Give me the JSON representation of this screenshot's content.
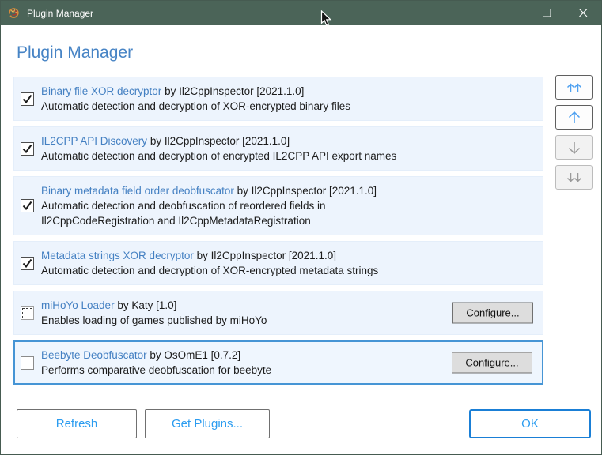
{
  "window": {
    "title": "Plugin Manager"
  },
  "header": {
    "title": "Plugin Manager"
  },
  "plugins": [
    {
      "name": "Binary file XOR decryptor",
      "byline": " by Il2CppInspector [2021.1.0]",
      "description": "Automatic detection and decryption of XOR-encrypted binary files",
      "state": "checked",
      "selected": false
    },
    {
      "name": "IL2CPP API Discovery",
      "byline": " by Il2CppInspector [2021.1.0]",
      "description": "Automatic detection and decryption of encrypted IL2CPP API export names",
      "state": "checked",
      "selected": false
    },
    {
      "name": "Binary metadata field order deobfuscator",
      "byline": " by Il2CppInspector [2021.1.0]",
      "description": "Automatic detection and deobfuscation of reordered fields in\nIl2CppCodeRegistration and Il2CppMetadataRegistration",
      "state": "checked",
      "selected": false
    },
    {
      "name": "Metadata strings XOR decryptor",
      "byline": " by Il2CppInspector [2021.1.0]",
      "description": "Automatic detection and decryption of XOR-encrypted metadata strings",
      "state": "checked",
      "selected": false
    },
    {
      "name": "miHoYo Loader",
      "byline": " by Katy [1.0]",
      "description": "Enables loading of games published by miHoYo",
      "state": "indeterminate",
      "selected": false,
      "configure_label": "Configure..."
    },
    {
      "name": "Beebyte Deobfuscator",
      "byline": " by OsOmE1 [0.7.2]",
      "description": "Performs comparative deobfuscation for beebyte",
      "state": "unchecked",
      "selected": true,
      "configure_label": "Configure..."
    }
  ],
  "footer": {
    "refresh_label": "Refresh",
    "get_plugins_label": "Get Plugins...",
    "ok_label": "OK"
  },
  "colors": {
    "titlebar": "#4b6458",
    "row_background": "#edf4fd",
    "selected_row_border": "#4695d5",
    "plugin_name_link": "#4480c2",
    "accent_blue": "#2b9cf0",
    "ok_border": "#1a7fd6"
  }
}
